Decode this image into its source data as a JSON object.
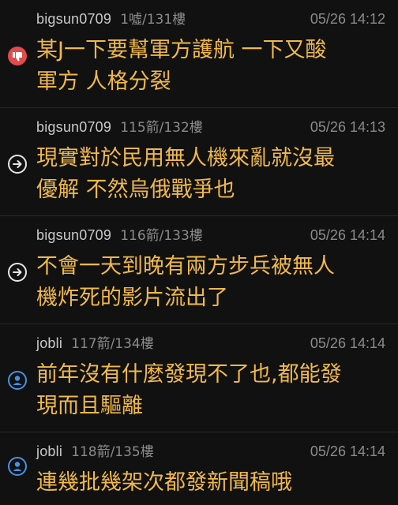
{
  "comments": [
    {
      "author": "bigsun0709",
      "floor": "1噓/131樓",
      "time": "05/26 14:12",
      "icon": "thumbs-down-icon",
      "icon_color": "#e04b4b",
      "text": "某J一下要幫軍方護航 一下又酸\n軍方 人格分裂"
    },
    {
      "author": "bigsun0709",
      "floor": "115箭/132樓",
      "time": "05/26 14:13",
      "icon": "arrow-right-circle-icon",
      "icon_color": "#e6e6e6",
      "text": "現實對於民用無人機來亂就沒最\n優解 不然烏俄戰爭也"
    },
    {
      "author": "bigsun0709",
      "floor": "116箭/133樓",
      "time": "05/26 14:14",
      "icon": "arrow-right-circle-icon",
      "icon_color": "#e6e6e6",
      "text": "不會一天到晚有兩方步兵被無人\n機炸死的影片流出了"
    },
    {
      "author": "jobli",
      "floor": "117箭/134樓",
      "time": "05/26 14:14",
      "icon": "user-circle-icon",
      "icon_color": "#4a90e2",
      "text": "前年沒有什麼發現不了也,都能發\n現而且驅離"
    },
    {
      "author": "jobli",
      "floor": "118箭/135樓",
      "time": "05/26 14:14",
      "icon": "user-circle-icon",
      "icon_color": "#4a90e2",
      "text": "連幾批幾架次都發新聞稿哦"
    }
  ]
}
